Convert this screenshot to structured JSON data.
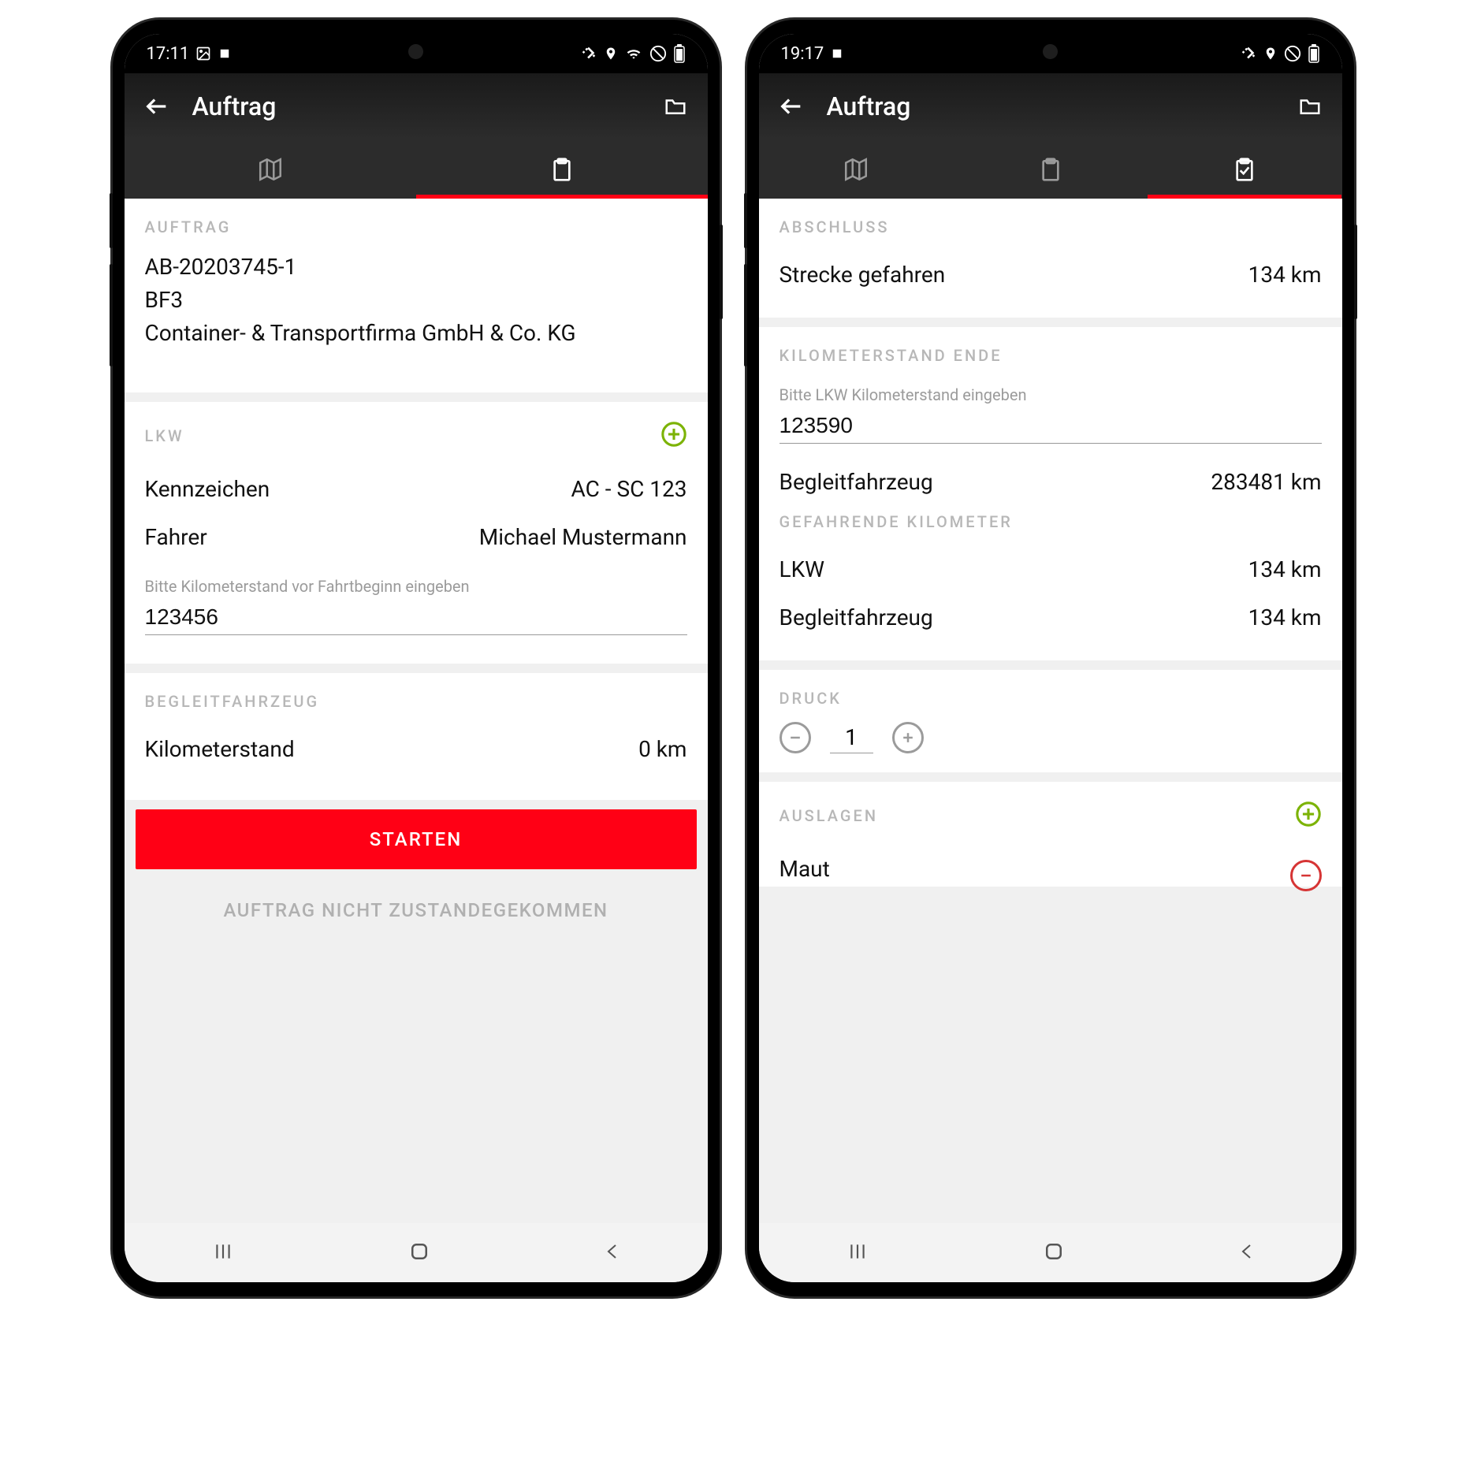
{
  "left": {
    "status_time": "17:11",
    "app_title": "Auftrag",
    "tabs_active_index": 1,
    "sections": {
      "auftrag": {
        "label": "AUFTRAG",
        "order_no": "AB-20203745-1",
        "type": "BF3",
        "company": "Container- & Transportfirma GmbH & Co. KG"
      },
      "lkw": {
        "label": "LKW",
        "plate_label": "Kennzeichen",
        "plate_value": "AC - SC 123",
        "driver_label": "Fahrer",
        "driver_value": "Michael Mustermann",
        "km_input_label": "Bitte Kilometerstand vor Fahrtbeginn eingeben",
        "km_input_value": "123456"
      },
      "begleit": {
        "label": "BEGLEITFAHRZEUG",
        "km_label": "Kilometerstand",
        "km_value": "0 km"
      }
    },
    "btn_start": "STARTEN",
    "btn_cancel": "AUFTRAG NICHT ZUSTANDEGEKOMMEN"
  },
  "right": {
    "status_time": "19:17",
    "app_title": "Auftrag",
    "tabs_active_index": 2,
    "sections": {
      "abschluss": {
        "label": "ABSCHLUSS",
        "row_label": "Strecke gefahren",
        "row_value": "134 km"
      },
      "km_ende": {
        "label": "KILOMETERSTAND ENDE",
        "km_input_label": "Bitte LKW Kilometerstand eingeben",
        "km_input_value": "123590",
        "begleit_label": "Begleitfahrzeug",
        "begleit_value": "283481 km",
        "gef_label": "GEFAHRENDE KILOMETER",
        "lkw_label": "LKW",
        "lkw_value": "134 km",
        "begleit2_label": "Begleitfahrzeug",
        "begleit2_value": "134 km"
      },
      "druck": {
        "label": "DRUCK",
        "value": "1"
      },
      "auslagen": {
        "label": "AUSLAGEN",
        "item": "Maut"
      }
    }
  }
}
